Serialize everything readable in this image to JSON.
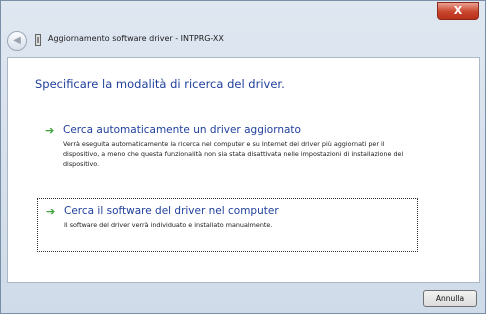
{
  "window": {
    "title": "Aggiornamento software driver - INTPRG-XX",
    "close_label": "X"
  },
  "heading": "Specificare la modalità di ricerca del driver.",
  "options": [
    {
      "title": "Cerca automaticamente un driver aggiornato",
      "description": "Verrà eseguita automaticamente la ricerca nel  computer e su Internet dei driver più aggiornati per il dispositivo, a meno che questa funzionalità non sia stata disattivata nelle impostazioni di installazione del dispositivo."
    },
    {
      "title": "Cerca il software del driver nel computer",
      "description": "Il software del driver verrà individuato e installato manualmente."
    }
  ],
  "footer": {
    "cancel_label": "Annulla"
  },
  "icons": {
    "back": "back-arrow-icon",
    "device": "device-driver-icon",
    "option_arrow": "green-arrow-icon"
  },
  "colors": {
    "link_blue": "#1f3f9c",
    "arrow_green": "#3aa33a",
    "close_red": "#c9452d"
  }
}
